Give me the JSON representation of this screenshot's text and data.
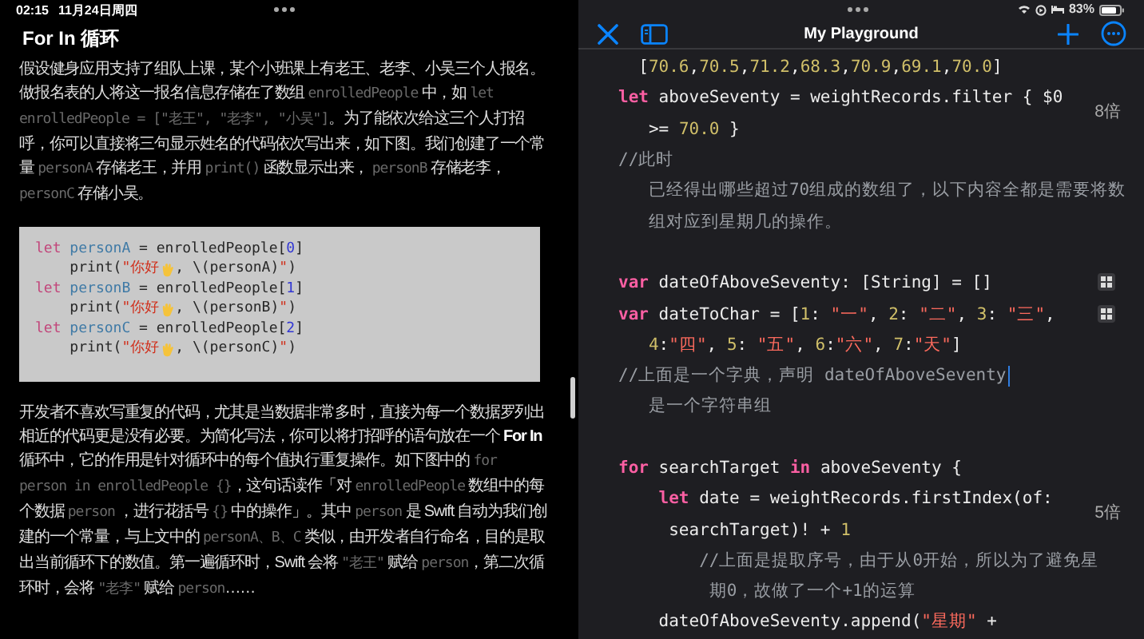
{
  "left_pane": {
    "status_time": "02:15",
    "status_date": "11月24日周四",
    "title": "For In 循环",
    "content": [
      {
        "kind": "paragraph",
        "segments": [
          {
            "kind": "text",
            "text": "假设健身应用支持了组队上课，某个小班课上有老王、老李、小吴三个人报名。做报名表的人将这一报名信息存储在了数组 "
          },
          {
            "kind": "code",
            "text": "enrolledPeople"
          },
          {
            "kind": "text",
            "text": " 中，如 "
          },
          {
            "kind": "code",
            "text": "let enrolledPeople = [\"老王\", \"老李\", \"小吴\"]"
          },
          {
            "kind": "text",
            "text": "。为了能依次给这三个人打招呼，你可以直接将三句显示姓名的代码依次写出来，如下图。我们创建了一个常量 "
          },
          {
            "kind": "code",
            "text": "personA"
          },
          {
            "kind": "text",
            "text": " 存储老王，并用 "
          },
          {
            "kind": "code",
            "text": "print()"
          },
          {
            "kind": "text",
            "text": " 函数显示出来， "
          },
          {
            "kind": "code",
            "text": "personB"
          },
          {
            "kind": "text",
            "text": " 存储老李， "
          },
          {
            "kind": "code",
            "text": "personC"
          },
          {
            "kind": "text",
            "text": " 存储小吴。"
          }
        ]
      },
      {
        "kind": "code",
        "lines": [
          [
            {
              "kind": "keyword",
              "text": "let"
            },
            {
              "kind": "ident",
              "text": " personA"
            },
            {
              "kind": "plain",
              "text": " = enrolledPeople["
            },
            {
              "kind": "number",
              "text": "0"
            },
            {
              "kind": "plain",
              "text": "]"
            }
          ],
          [
            {
              "kind": "plain",
              "text": "    print("
            },
            {
              "kind": "string",
              "text": "\"你好"
            },
            {
              "kind": "emoji"
            },
            {
              "kind": "plain",
              "text": ", \\(personA)"
            },
            {
              "kind": "string",
              "text": "\""
            },
            {
              "kind": "plain",
              "text": ")"
            }
          ],
          [
            {
              "kind": "keyword",
              "text": "let"
            },
            {
              "kind": "ident",
              "text": " personB"
            },
            {
              "kind": "plain",
              "text": " = enrolledPeople["
            },
            {
              "kind": "number",
              "text": "1"
            },
            {
              "kind": "plain",
              "text": "]"
            }
          ],
          [
            {
              "kind": "plain",
              "text": "    print("
            },
            {
              "kind": "string",
              "text": "\"你好"
            },
            {
              "kind": "emoji"
            },
            {
              "kind": "plain",
              "text": ", \\(personB)"
            },
            {
              "kind": "string",
              "text": "\""
            },
            {
              "kind": "plain",
              "text": ")"
            }
          ],
          [
            {
              "kind": "keyword",
              "text": "let"
            },
            {
              "kind": "ident",
              "text": " personC"
            },
            {
              "kind": "plain",
              "text": " = enrolledPeople["
            },
            {
              "kind": "number",
              "text": "2"
            },
            {
              "kind": "plain",
              "text": "]"
            }
          ],
          [
            {
              "kind": "plain",
              "text": "    print("
            },
            {
              "kind": "string",
              "text": "\"你好"
            },
            {
              "kind": "emoji"
            },
            {
              "kind": "plain",
              "text": ", \\(personC)"
            },
            {
              "kind": "string",
              "text": "\""
            },
            {
              "kind": "plain",
              "text": ")"
            }
          ]
        ]
      },
      {
        "kind": "paragraph",
        "segments": [
          {
            "kind": "text",
            "text": "开发者不喜欢写重复的代码，尤其是当数据非常多时，直接为每一个数据罗列出相近的代码更是没有必要。为简化写法，你可以将打招呼的语句放在一个 "
          },
          {
            "kind": "bold",
            "text": "For In"
          },
          {
            "kind": "text",
            "text": " 循环中，它的作用是针对循环中的每个值执行重复操作。如下图中的 "
          },
          {
            "kind": "code",
            "text": "for person in enrolledPeople {}"
          },
          {
            "kind": "text",
            "text": "，这句话读作「对 "
          },
          {
            "kind": "code",
            "text": "enrolledPeople"
          },
          {
            "kind": "text",
            "text": " 数组中的每个数据 "
          },
          {
            "kind": "code",
            "text": "person"
          },
          {
            "kind": "text",
            "text": " ，进行花括号 "
          },
          {
            "kind": "code",
            "text": "{}"
          },
          {
            "kind": "text",
            "text": " 中的操作」。其中 "
          },
          {
            "kind": "code",
            "text": "person"
          },
          {
            "kind": "text",
            "text": " 是 Swift 自动为我们创建的一个常量，与上文中的 "
          },
          {
            "kind": "code",
            "text": "personA、B、C"
          },
          {
            "kind": "text",
            "text": " 类似，由开发者自行命名，目的是取出当前循环下的数值。第一遍循环时，Swift 会将 "
          },
          {
            "kind": "code",
            "text": "\"老王\""
          },
          {
            "kind": "text",
            "text": " 赋给 "
          },
          {
            "kind": "code",
            "text": "person"
          },
          {
            "kind": "text",
            "text": "，第二次循环时，会将 "
          },
          {
            "kind": "code",
            "text": "\"老李\""
          },
          {
            "kind": "text",
            "text": " 赋给 "
          },
          {
            "kind": "code",
            "text": "person"
          },
          {
            "kind": "text",
            "text": "……"
          }
        ]
      }
    ]
  },
  "right_pane": {
    "battery_text": "83%",
    "toolbar": {
      "title": "My Playground"
    },
    "lines": [
      {
        "kind": "code",
        "view_button": false,
        "cursor": false,
        "tokens": [
          {
            "kind": "plain",
            "text": "  ["
          },
          {
            "kind": "number",
            "text": "70.6"
          },
          {
            "kind": "plain",
            "text": ","
          },
          {
            "kind": "number",
            "text": "70.5"
          },
          {
            "kind": "plain",
            "text": ","
          },
          {
            "kind": "number",
            "text": "71.2"
          },
          {
            "kind": "plain",
            "text": ","
          },
          {
            "kind": "number",
            "text": "68.3"
          },
          {
            "kind": "plain",
            "text": ","
          },
          {
            "kind": "number",
            "text": "70.9"
          },
          {
            "kind": "plain",
            "text": ","
          },
          {
            "kind": "number",
            "text": "69.1"
          },
          {
            "kind": "plain",
            "text": ","
          },
          {
            "kind": "number",
            "text": "70.0"
          },
          {
            "kind": "plain",
            "text": "]"
          }
        ]
      },
      {
        "kind": "code",
        "view_button": false,
        "cursor": false,
        "result": "8倍",
        "tokens": [
          {
            "kind": "keyword",
            "text": "let"
          },
          {
            "kind": "plain",
            "text": " aboveSeventy = weightRecords.filter { $0"
          }
        ]
      },
      {
        "kind": "code",
        "view_button": false,
        "cursor": false,
        "tokens": [
          {
            "kind": "plain",
            "text": "   >= "
          },
          {
            "kind": "number",
            "text": "70.0"
          },
          {
            "kind": "plain",
            "text": " }"
          }
        ]
      },
      {
        "kind": "code",
        "view_button": false,
        "cursor": false,
        "tokens": [
          {
            "kind": "comment",
            "text": "//此时"
          }
        ]
      },
      {
        "kind": "code",
        "view_button": false,
        "cursor": false,
        "tokens": [
          {
            "kind": "comment",
            "text": "   已经得出哪些超过70组成的数组了，以下内容全都是需要将数"
          }
        ]
      },
      {
        "kind": "code",
        "view_button": false,
        "cursor": false,
        "tokens": [
          {
            "kind": "comment",
            "text": "   组对应到星期几的操作。"
          }
        ]
      },
      {
        "kind": "blank"
      },
      {
        "kind": "code",
        "view_button": true,
        "cursor": false,
        "tokens": [
          {
            "kind": "keyword",
            "text": "var"
          },
          {
            "kind": "plain",
            "text": " dateOfAboveSeventy: [String] = []"
          }
        ]
      },
      {
        "kind": "code",
        "view_button": true,
        "cursor": false,
        "tokens": [
          {
            "kind": "keyword",
            "text": "var"
          },
          {
            "kind": "plain",
            "text": " dateToChar = ["
          },
          {
            "kind": "number",
            "text": "1"
          },
          {
            "kind": "plain",
            "text": ": "
          },
          {
            "kind": "string",
            "text": "\"一\""
          },
          {
            "kind": "plain",
            "text": ", "
          },
          {
            "kind": "number",
            "text": "2"
          },
          {
            "kind": "plain",
            "text": ": "
          },
          {
            "kind": "string",
            "text": "\"二\""
          },
          {
            "kind": "plain",
            "text": ", "
          },
          {
            "kind": "number",
            "text": "3"
          },
          {
            "kind": "plain",
            "text": ": "
          },
          {
            "kind": "string",
            "text": "\"三\""
          },
          {
            "kind": "plain",
            "text": ","
          }
        ]
      },
      {
        "kind": "code",
        "view_button": false,
        "cursor": false,
        "tokens": [
          {
            "kind": "number",
            "text": "   4"
          },
          {
            "kind": "plain",
            "text": ":"
          },
          {
            "kind": "string",
            "text": "\"四\""
          },
          {
            "kind": "plain",
            "text": ", "
          },
          {
            "kind": "number",
            "text": "5"
          },
          {
            "kind": "plain",
            "text": ": "
          },
          {
            "kind": "string",
            "text": "\"五\""
          },
          {
            "kind": "plain",
            "text": ", "
          },
          {
            "kind": "number",
            "text": "6"
          },
          {
            "kind": "plain",
            "text": ":"
          },
          {
            "kind": "string",
            "text": "\"六\""
          },
          {
            "kind": "plain",
            "text": ", "
          },
          {
            "kind": "number",
            "text": "7"
          },
          {
            "kind": "plain",
            "text": ":"
          },
          {
            "kind": "string",
            "text": "\"天\""
          },
          {
            "kind": "plain",
            "text": "]"
          }
        ]
      },
      {
        "kind": "code",
        "view_button": false,
        "cursor": true,
        "tokens": [
          {
            "kind": "comment",
            "text": "//上面是一个字典，声明 dateOfAboveSeventy"
          }
        ]
      },
      {
        "kind": "code",
        "view_button": false,
        "cursor": false,
        "tokens": [
          {
            "kind": "comment",
            "text": "   是一个字符串组"
          }
        ]
      },
      {
        "kind": "blank"
      },
      {
        "kind": "code",
        "view_button": false,
        "cursor": false,
        "tokens": [
          {
            "kind": "keyword",
            "text": "for"
          },
          {
            "kind": "plain",
            "text": " searchTarget "
          },
          {
            "kind": "keyword",
            "text": "in"
          },
          {
            "kind": "plain",
            "text": " aboveSeventy {"
          }
        ]
      },
      {
        "kind": "code",
        "view_button": false,
        "cursor": false,
        "result": "5倍",
        "tokens": [
          {
            "kind": "keyword",
            "text": "    let"
          },
          {
            "kind": "plain",
            "text": " date = weightRecords.firstIndex(of:"
          }
        ]
      },
      {
        "kind": "code",
        "view_button": false,
        "cursor": false,
        "tokens": [
          {
            "kind": "plain",
            "text": "     searchTarget)! + "
          },
          {
            "kind": "number",
            "text": "1"
          }
        ]
      },
      {
        "kind": "code",
        "view_button": false,
        "cursor": false,
        "tokens": [
          {
            "kind": "comment",
            "text": "        //上面是提取序号，由于从0开始，所以为了避免星"
          }
        ]
      },
      {
        "kind": "code",
        "view_button": false,
        "cursor": false,
        "tokens": [
          {
            "kind": "comment",
            "text": "         期0，故做了一个+1的运算"
          }
        ]
      },
      {
        "kind": "code",
        "view_button": false,
        "cursor": false,
        "tokens": [
          {
            "kind": "plain",
            "text": "    dateOfAboveSeventy.append("
          },
          {
            "kind": "string",
            "text": "\"星期\""
          },
          {
            "kind": "plain",
            "text": " +"
          }
        ]
      }
    ]
  }
}
